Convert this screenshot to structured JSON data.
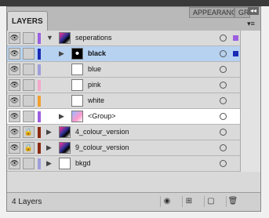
{
  "panel": {
    "tabs": [
      {
        "label": "LAYERS",
        "active": true
      },
      {
        "label": "APPEARANCE",
        "active": false
      },
      {
        "label": "GRA",
        "active": false
      }
    ],
    "collapse_glyph": "◂◂",
    "menu_glyph": "▾≡"
  },
  "layers": [
    {
      "name": "seperations",
      "bold": false,
      "expanded": true,
      "has_triangle": true,
      "color": "#9c5fe0",
      "thumb": "swatch-multi",
      "lock_icon": "",
      "selected": false,
      "white": false,
      "sel_color": "#9c5fe0"
    },
    {
      "name": "black",
      "bold": true,
      "expanded": false,
      "has_triangle": true,
      "color": "#1a2bb5",
      "thumb": "swatch-black",
      "lock_icon": "",
      "selected": true,
      "white": false,
      "sel_color": "#1a2bb5"
    },
    {
      "name": "blue",
      "bold": false,
      "expanded": false,
      "has_triangle": false,
      "color": "#9e9eda",
      "thumb": "empty",
      "lock_icon": "",
      "selected": false,
      "white": false,
      "sel_color": ""
    },
    {
      "name": "pink",
      "bold": false,
      "expanded": false,
      "has_triangle": false,
      "color": "#f5a7c8",
      "thumb": "empty",
      "lock_icon": "",
      "selected": false,
      "white": false,
      "sel_color": ""
    },
    {
      "name": "white",
      "bold": false,
      "expanded": false,
      "has_triangle": false,
      "color": "#f0a030",
      "thumb": "empty",
      "lock_icon": "",
      "selected": false,
      "white": false,
      "sel_color": ""
    },
    {
      "name": "<Group>",
      "bold": false,
      "expanded": false,
      "has_triangle": true,
      "color": "#9c5fe0",
      "thumb": "swatch-group",
      "lock_icon": "",
      "selected": false,
      "white": true,
      "sel_color": ""
    },
    {
      "name": "4_colour_version",
      "bold": false,
      "expanded": false,
      "has_triangle": true,
      "color": "#8a2a10",
      "thumb": "swatch-multi",
      "lock_icon": "🔒",
      "selected": false,
      "white": false,
      "sel_color": ""
    },
    {
      "name": "9_colour_version",
      "bold": false,
      "expanded": false,
      "has_triangle": true,
      "color": "#8a2a10",
      "thumb": "swatch-multi",
      "lock_icon": "🔒",
      "selected": false,
      "white": false,
      "sel_color": ""
    },
    {
      "name": "bkgd",
      "bold": false,
      "expanded": false,
      "has_triangle": true,
      "color": "#9e9eda",
      "thumb": "empty",
      "lock_icon": "",
      "selected": false,
      "white": false,
      "sel_color": ""
    }
  ],
  "eye_glyph": "👁",
  "footer": {
    "count": "4 Layers",
    "buttons": [
      {
        "name": "make-clipping-mask",
        "glyph": "◉"
      },
      {
        "name": "new-sublayer",
        "glyph": "⊞"
      },
      {
        "name": "new-layer",
        "glyph": "▢"
      },
      {
        "name": "delete",
        "glyph": "🗑"
      }
    ]
  }
}
